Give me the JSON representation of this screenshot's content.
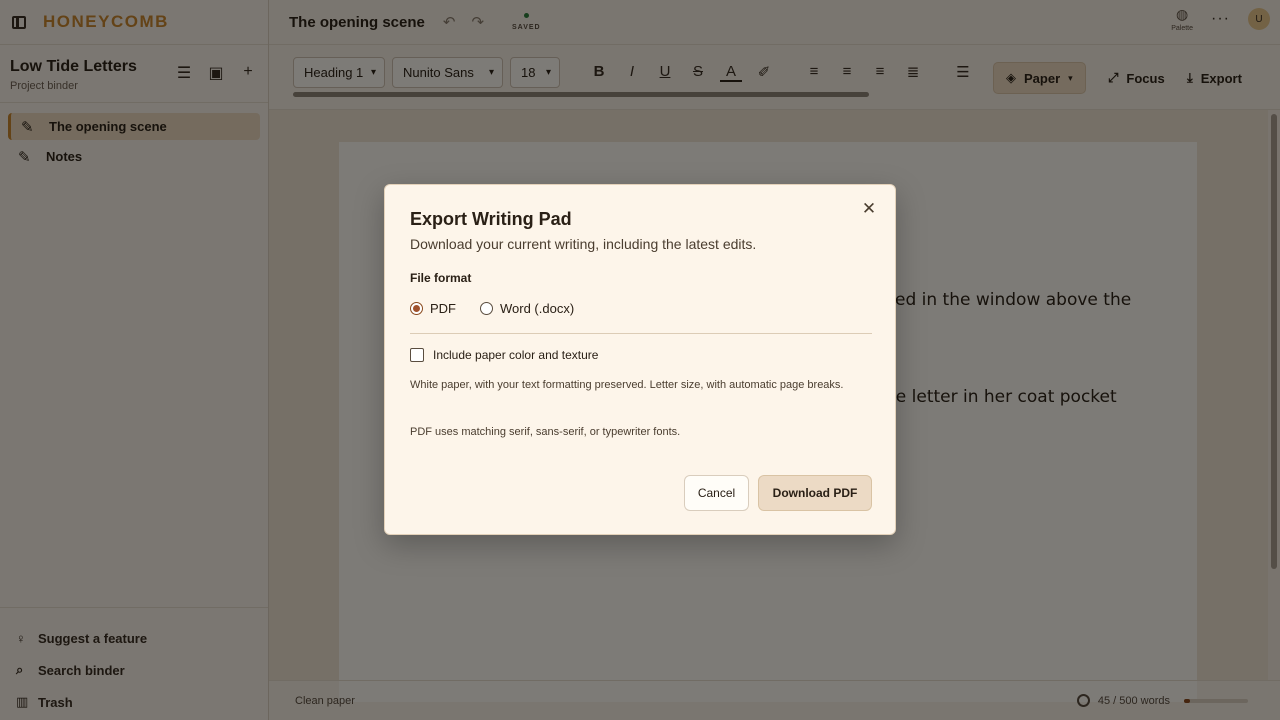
{
  "app": {
    "brand": "HONEYCOMB"
  },
  "sidebar": {
    "project_title": "Low Tide Letters",
    "project_subtitle": "Project binder",
    "documents": [
      {
        "label": "The opening scene",
        "active": true
      },
      {
        "label": "Notes",
        "active": false
      }
    ],
    "footer_links": [
      {
        "label": "Suggest a feature",
        "icon": "lightbulb-icon"
      },
      {
        "label": "Search binder",
        "icon": "search-icon"
      },
      {
        "label": "Trash",
        "icon": "trash-icon"
      }
    ]
  },
  "header": {
    "doc_title": "The opening scene",
    "save_status": "SAVED",
    "palette_label": "Palette",
    "avatar_initial": "U"
  },
  "toolbar": {
    "style_select": "Heading 1",
    "font_select": "Nunito Sans",
    "size_select": "18",
    "paper_label": "Paper",
    "focus_label": "Focus",
    "export_label": "Export"
  },
  "editor": {
    "visible_line_1": "ed in the window above the",
    "visible_line_2": "ne letter in her coat pocket"
  },
  "status_bar": {
    "paper_mode": "Clean paper",
    "word_count": "45 / 500 words",
    "word_progress": 0.09
  },
  "dialog": {
    "title": "Export Writing Pad",
    "description": "Download your current writing, including the latest edits.",
    "format_label": "File format",
    "format_options": [
      {
        "label": "PDF",
        "selected": true
      },
      {
        "label": "Word (.docx)",
        "selected": false
      }
    ],
    "include_paper_label": "Include paper color and texture",
    "include_paper_checked": false,
    "note_1": "White paper, with your text formatting preserved. Letter size, with automatic page breaks.",
    "note_2": "PDF uses matching serif, sans-serif, or typewriter fonts.",
    "cancel_label": "Cancel",
    "download_label": "Download PDF"
  },
  "colors": {
    "accent": "#c9862e",
    "primary_button": "#ecdac5",
    "radio_selected": "#a0522d"
  }
}
